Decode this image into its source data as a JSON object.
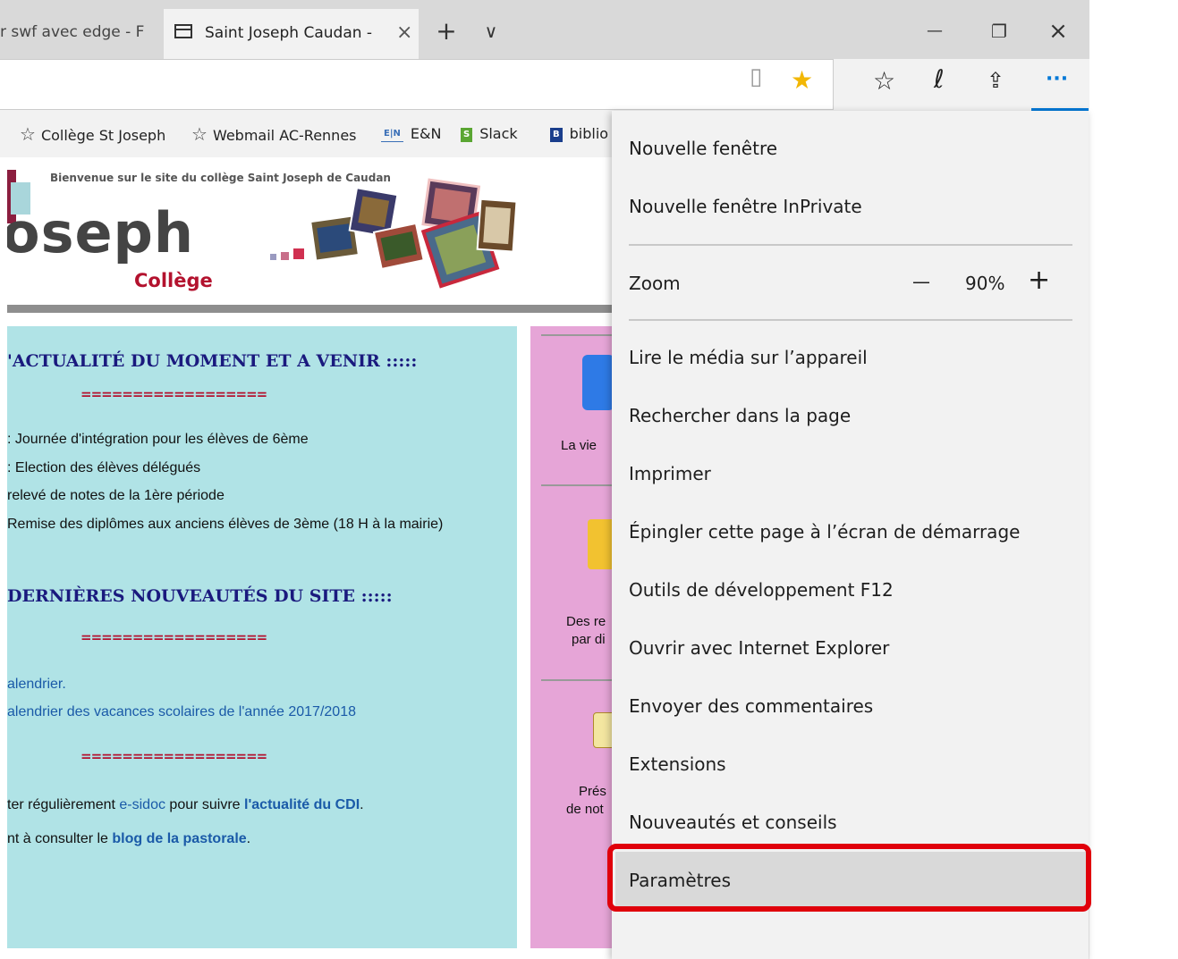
{
  "tabs": {
    "previous_title": "r swf avec edge - F",
    "active_title": "Saint Joseph Caudan - A",
    "close_glyph": "×",
    "new_tab_glyph": "+",
    "tab_list_glyph": "∨"
  },
  "window_controls": {
    "minimize": "—",
    "restore": "❐",
    "close": "×"
  },
  "toolbar": {
    "reading_view_glyph": "▯",
    "favorite_star_glyph": "★",
    "favorites_hub_glyph": "☆",
    "web_note_glyph": "ℓ",
    "share_glyph": "⇪",
    "more_glyph": "···"
  },
  "favorites_bar": [
    {
      "label": "Collège St Joseph",
      "icon": "star-outline-icon"
    },
    {
      "label": "Webmail AC-Rennes",
      "icon": "star-outline-icon"
    },
    {
      "label": "E&N",
      "badge": "E|N",
      "icon": "en-icon"
    },
    {
      "label": "Slack",
      "badge": "S",
      "icon": "slack-icon"
    },
    {
      "label": "biblio",
      "badge": "B",
      "icon": "b-icon"
    }
  ],
  "page": {
    "banner_text": "Bienvenue sur le site du collège Saint Joseph de Caudan",
    "logo_main": "oseph",
    "logo_sub": "Collège",
    "news_heading_1": "'ACTUALITÉ DU MOMENT  ET A VENIR  :::::",
    "separator": "==================",
    "news_items": [
      ": Journée d'intégration pour les élèves de 6ème",
      ": Election des élèves délégués",
      "relevé de notes de la 1ère période",
      "Remise des diplômes aux anciens élèves de 3ème (18 H à la mairie)"
    ],
    "news_heading_2": "DERNIÈRES NOUVEAUTÉS DU SITE  :::::",
    "site_news": [
      "alendrier.",
      "alendrier des vacances scolaires de l'année 2017/2018"
    ],
    "cdi_line": {
      "before": "ter régulièrement ",
      "link1": "e-sidoc",
      "middle": " pour suivre ",
      "link2": "l'actualité du CDI",
      "after": "."
    },
    "pastorale_line": {
      "before": "nt à consulter le ",
      "link": "blog de la pastorale",
      "after": "."
    },
    "side_texts": [
      "La vie",
      "Des re",
      "par di",
      "Prés",
      "de not"
    ]
  },
  "menu": {
    "items": [
      "Nouvelle fenêtre",
      "Nouvelle fenêtre InPrivate",
      "Zoom",
      "Lire le média sur l’appareil",
      "Rechercher dans la page",
      "Imprimer",
      "Épingler cette page à l’écran de démarrage",
      "Outils de développement F12",
      "Ouvrir avec Internet Explorer",
      "Envoyer des commentaires",
      "Extensions",
      "Nouveautés et conseils",
      "Paramètres"
    ],
    "zoom_minus": "—",
    "zoom_value": "90%",
    "zoom_plus": "+"
  },
  "colors": {
    "highlight_border": "#e0000b",
    "news_panel_bg": "#b0e3e6",
    "side_panel_bg": "#e6a5d7",
    "accent_blue": "#0078d7"
  }
}
